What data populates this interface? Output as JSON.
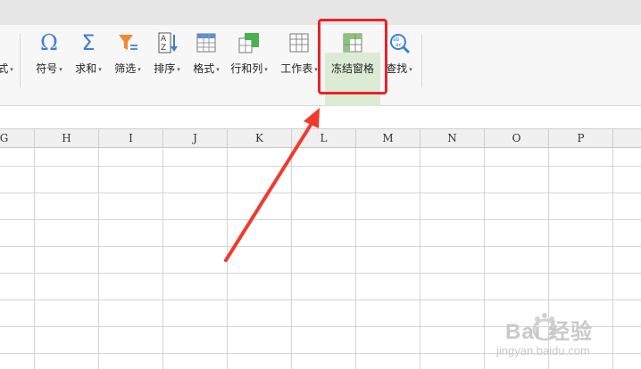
{
  "toolbar": {
    "partial_label": "式",
    "buttons": [
      {
        "label": "符号",
        "icon": "omega-symbol-icon"
      },
      {
        "label": "求和",
        "icon": "sigma-sum-icon"
      },
      {
        "label": "筛选",
        "icon": "funnel-filter-icon"
      },
      {
        "label": "排序",
        "icon": "az-sort-icon"
      },
      {
        "label": "格式",
        "icon": "table-format-icon"
      },
      {
        "label": "行和列",
        "icon": "rows-columns-icon"
      },
      {
        "label": "工作表",
        "icon": "worksheet-icon"
      },
      {
        "label": "冻结窗格",
        "icon": "freeze-panes-icon"
      },
      {
        "label": "查找",
        "icon": "find-magnifier-icon"
      }
    ]
  },
  "columns": [
    "G",
    "H",
    "I",
    "J",
    "K",
    "L",
    "M",
    "N",
    "O",
    "P"
  ],
  "watermark": {
    "text": "Bai 经验",
    "url": "jingyan.baidu.com"
  },
  "colors": {
    "highlight_box": "#e8232b",
    "arrow": "#f03a2e",
    "freeze_bg": "#dcebd3"
  }
}
